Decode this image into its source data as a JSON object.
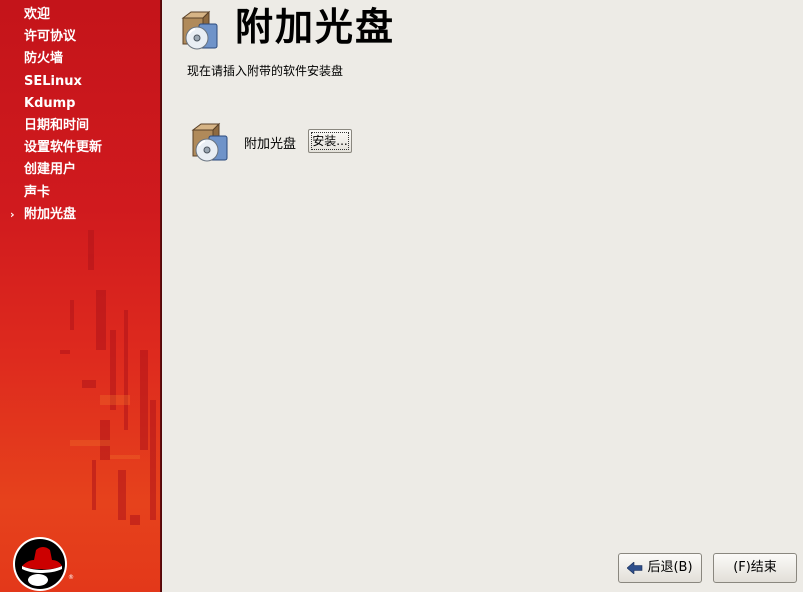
{
  "sidebar": {
    "items": [
      {
        "label": "欢迎"
      },
      {
        "label": "许可协议"
      },
      {
        "label": "防火墙"
      },
      {
        "label": "SELinux"
      },
      {
        "label": "Kdump"
      },
      {
        "label": "日期和时间"
      },
      {
        "label": "设置软件更新"
      },
      {
        "label": "创建用户"
      },
      {
        "label": "声卡"
      },
      {
        "label": "附加光盘",
        "current": true
      }
    ],
    "current_marker": "›",
    "logo_icon": "redhat-shadowman-logo"
  },
  "main": {
    "title": "附加光盘",
    "subtitle": "现在请插入附带的软件安装盘",
    "disc_label": "附加光盘",
    "install_button": "安装...",
    "header_icon": "package-disc-icon"
  },
  "footer": {
    "back_label": "后退(B)",
    "finish_label": "(F)结束"
  },
  "colors": {
    "sidebar_red": "#d01a1e",
    "background": "#edebe6",
    "back_arrow": "#2e4f8c"
  }
}
